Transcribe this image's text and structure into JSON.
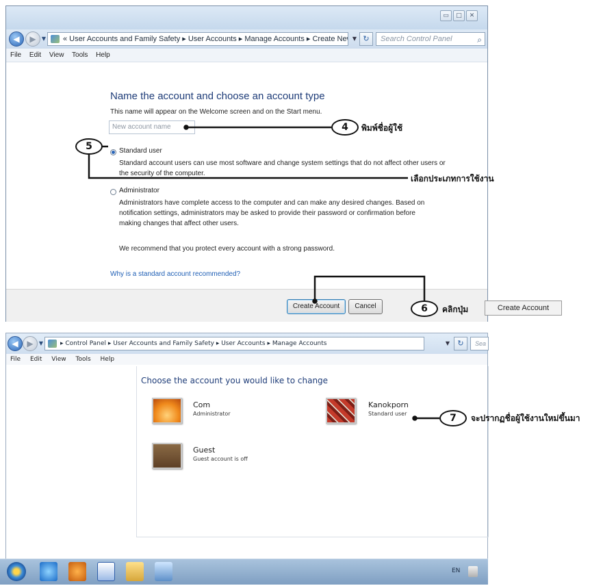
{
  "top_window": {
    "window_controls": {
      "minimize": "▭",
      "maximize": "□",
      "close": "✕"
    },
    "breadcrumb": "« User Accounts and Family Safety ▸ User Accounts ▸ Manage Accounts ▸ Create New Account",
    "search_placeholder": "Search Control Panel",
    "menu": [
      "File",
      "Edit",
      "View",
      "Tools",
      "Help"
    ],
    "heading": "Name the account and choose an account type",
    "description": "This name will appear on the Welcome screen and on the Start menu.",
    "name_input_placeholder": "New account name",
    "standard": {
      "label": "Standard user",
      "desc_line1": "Standard account users can use most software and change system settings that do not affect other users or",
      "desc_line2": "the security of the computer."
    },
    "admin": {
      "label": "Administrator",
      "desc_line1": "Administrators have complete access to the computer and can make any desired changes. Based on",
      "desc_line2": "notification settings, administrators may be asked to provide their password or confirmation before",
      "desc_line3": "making changes that affect other users."
    },
    "recommend": "We recommend that you protect every account with a strong password.",
    "why_link": "Why is a standard account recommended?",
    "create_button": "Create Account",
    "cancel_button": "Cancel"
  },
  "bottom_window": {
    "breadcrumb": "▸ Control Panel ▸ User Accounts and Family Safety ▸ User Accounts ▸ Manage Accounts",
    "search_partial": "Sea",
    "menu": [
      "File",
      "Edit",
      "View",
      "Tools",
      "Help"
    ],
    "heading": "Choose the account you would like to change",
    "accounts": [
      {
        "name": "Com",
        "type": "Administrator"
      },
      {
        "name": "Kanokporn",
        "type": "Standard user"
      },
      {
        "name": "Guest",
        "type": "Guest account is off"
      }
    ]
  },
  "taskbar": {
    "language": "EN"
  },
  "annotations": {
    "step4": {
      "number": "4",
      "text": "พิมพ์ชื่อผู้ใช้"
    },
    "step5": {
      "number": "5",
      "text": "เลือกประเภทการใช้งาน"
    },
    "step6": {
      "number": "6",
      "text": "คลิกปุ่ม",
      "button_label": "Create Account"
    },
    "step7": {
      "number": "7",
      "text": "จะปรากฏชื่อผู้ใช้งานใหม่ขึ้นมา"
    }
  },
  "colors": {
    "heading_blue": "#1e3c78",
    "link_blue": "#1f5fb5",
    "window_chrome": "#cddcee"
  }
}
